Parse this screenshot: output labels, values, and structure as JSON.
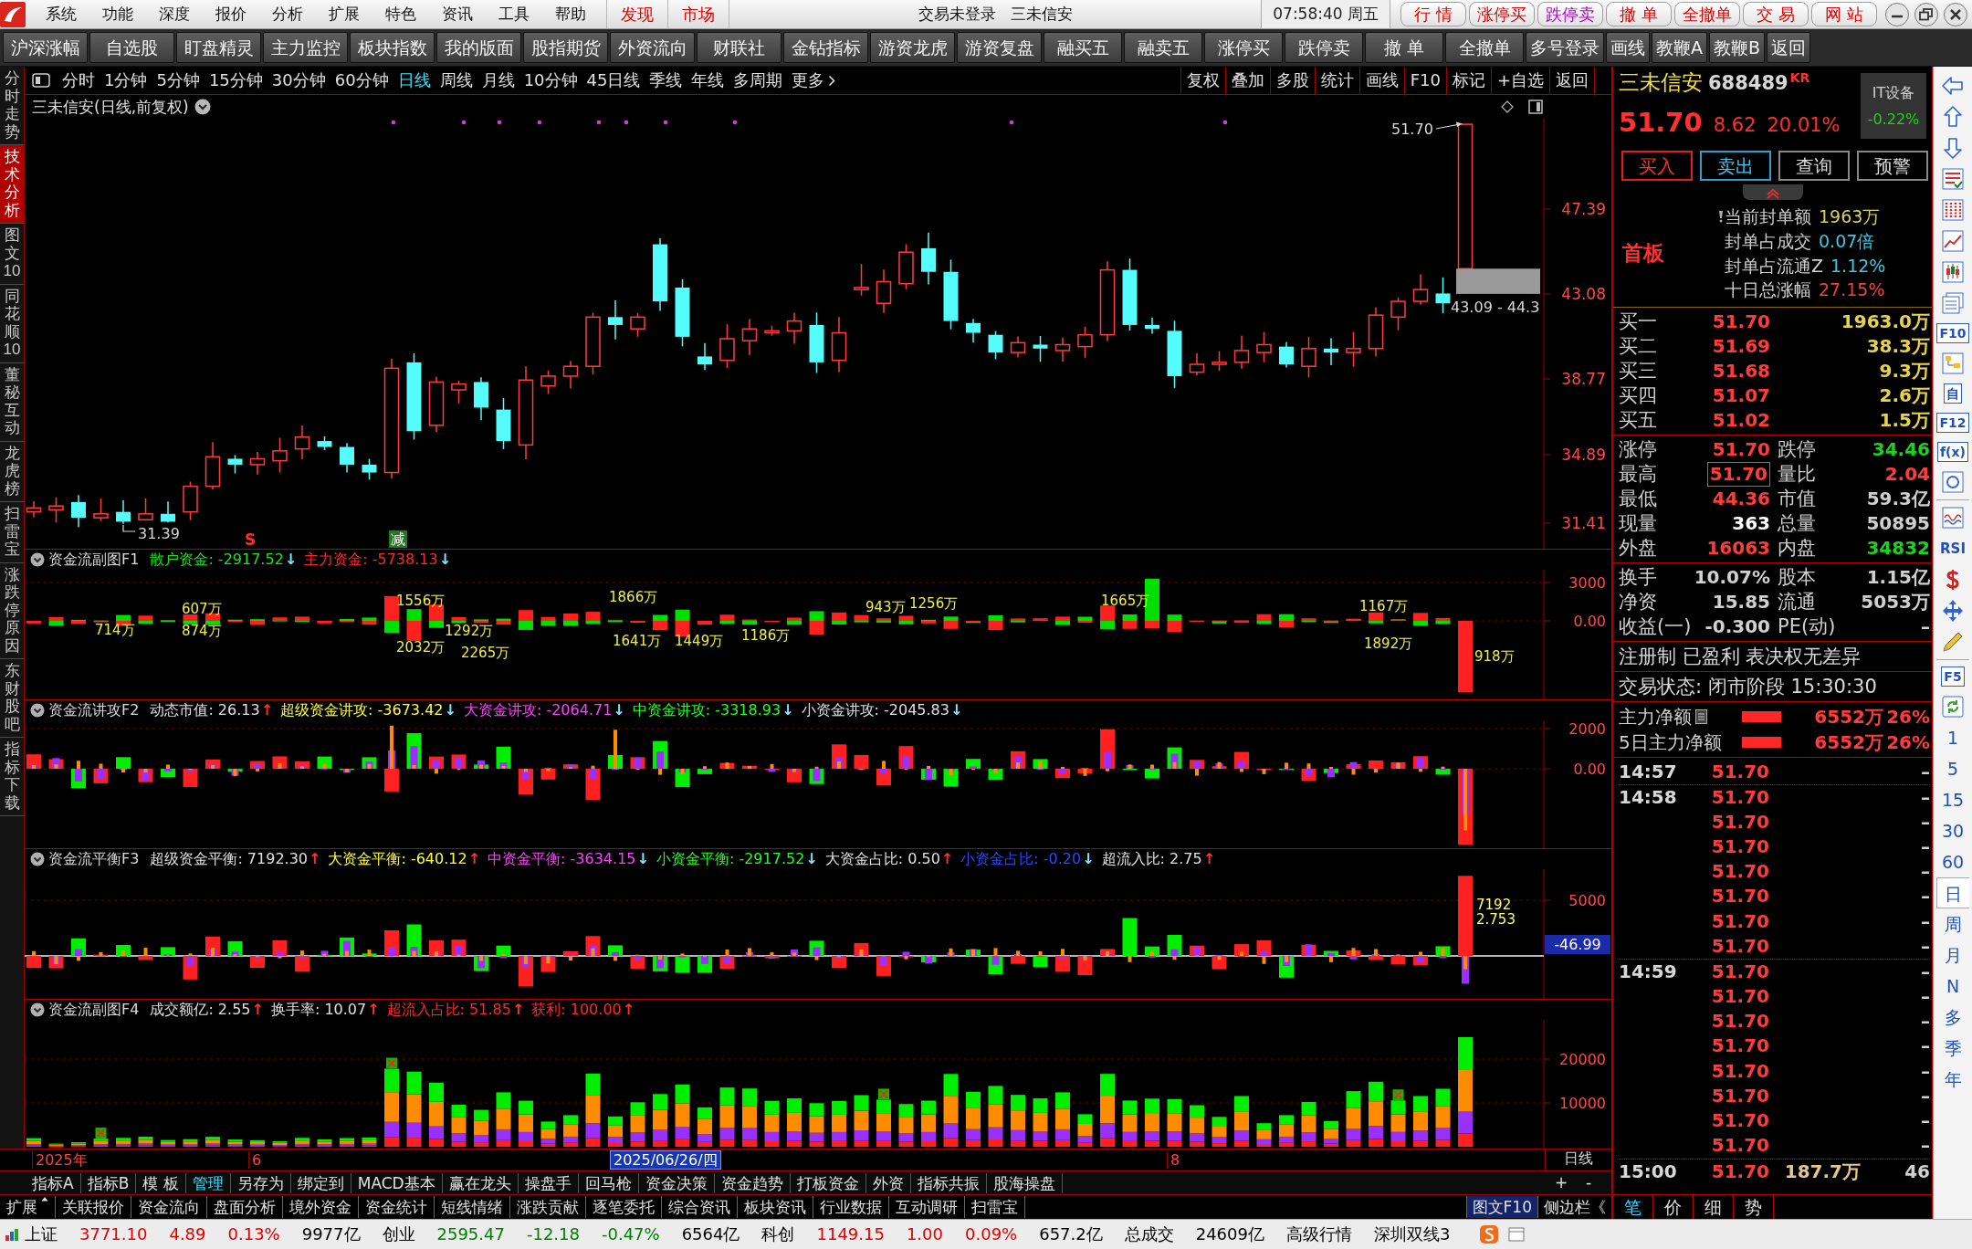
{
  "title_bar": {
    "menus": [
      "系统",
      "功能",
      "深度",
      "报价",
      "分析",
      "扩展",
      "特色",
      "资讯",
      "工具",
      "帮助"
    ],
    "channels": [
      "发现",
      "市场"
    ],
    "login_status": "交易未登录",
    "stock_name": "三未信安",
    "clock": "07:58:40 周五",
    "quick_buttons": [
      {
        "label": "行 情",
        "color": "#e00000"
      },
      {
        "label": "涨停买",
        "color": "#e00000"
      },
      {
        "label": "跌停卖",
        "color": "#b000c8"
      },
      {
        "label": "撤 单",
        "color": "#e00000"
      },
      {
        "label": "全撤单",
        "color": "#e00000"
      },
      {
        "label": "交 易",
        "color": "#e00000"
      },
      {
        "label": "网 站",
        "color": "#e00000"
      }
    ]
  },
  "toolbar": [
    "沪深涨幅",
    "自选股",
    "盯盘精灵",
    "主力监控",
    "板块指数",
    "我的版面",
    "股指期货",
    "外资流向",
    "财联社",
    "金钻指标",
    "游资龙虎",
    "游资复盘",
    "融买五",
    "融卖五",
    "涨停买",
    "跌停卖",
    "撤 单",
    "全撤单",
    "多号登录",
    "画线",
    "教鞭A",
    "教鞭B",
    "返回"
  ],
  "side_tabs": [
    {
      "label": "分时走势",
      "selected": false
    },
    {
      "label": "技术分析",
      "selected": true
    },
    {
      "label": "图文10",
      "selected": false
    },
    {
      "label": "同花顺10",
      "selected": false
    },
    {
      "label": "董秘互动",
      "selected": false
    },
    {
      "label": "龙虎榜",
      "selected": false
    },
    {
      "label": "扫雷宝",
      "selected": false
    },
    {
      "label": "涨跌停原因",
      "selected": false
    },
    {
      "label": "东财股吧",
      "selected": false
    },
    {
      "label": "指标下载",
      "selected": false
    }
  ],
  "period_bar": {
    "periods": [
      {
        "label": "分时",
        "selected": false
      },
      {
        "label": "1分钟",
        "selected": false
      },
      {
        "label": "5分钟",
        "selected": false
      },
      {
        "label": "15分钟",
        "selected": false
      },
      {
        "label": "30分钟",
        "selected": false
      },
      {
        "label": "60分钟",
        "selected": false
      },
      {
        "label": "日线",
        "selected": true
      },
      {
        "label": "周线",
        "selected": false
      },
      {
        "label": "月线",
        "selected": false
      },
      {
        "label": "10分钟",
        "selected": false
      },
      {
        "label": "45日线",
        "selected": false
      },
      {
        "label": "季线",
        "selected": false
      },
      {
        "label": "年线",
        "selected": false
      },
      {
        "label": "多周期",
        "selected": false
      }
    ],
    "more": "更多",
    "tools": [
      "复权",
      "叠加",
      "多股",
      "统计",
      "画线",
      "F10",
      "标记",
      "+自选",
      "返回"
    ]
  },
  "main_chart": {
    "title": "三未信安(日线,前复权)",
    "yticks": [
      "47.39",
      "43.08",
      "38.77",
      "34.89",
      "31.41"
    ],
    "high_label": "51.70",
    "range_label": "43.09 - 44.3",
    "low_label": "31.39",
    "markers": [
      {
        "kind": "sell",
        "label": "S"
      },
      {
        "kind": "reduce",
        "label": "减"
      }
    ]
  },
  "indicators": [
    {
      "title": "资金流副图F1",
      "readings": [
        {
          "kind": "value",
          "text": "散户资金: -2917.52",
          "color": "#20e020"
        },
        {
          "kind": "arrow",
          "text": "↓",
          "color": "#80e8ff"
        },
        {
          "kind": "value",
          "text": "主力资金: -5738.13",
          "color": "#ff2828"
        },
        {
          "kind": "arrow",
          "text": "↓",
          "color": "#80e8ff"
        }
      ],
      "yticks": [
        "3000",
        "0.00"
      ],
      "value_labels": [
        "714万",
        "607万",
        "874万",
        "1556万",
        "2032万",
        "1292万",
        "2265万",
        "1866万",
        "1641万",
        "1449万",
        "1186万",
        "943万",
        "1256万",
        "1665万",
        "1167万",
        "1892万",
        "918万"
      ]
    },
    {
      "title": "资金流讲攻F2",
      "readings": [
        {
          "kind": "value",
          "text": "动态市值: 26.13",
          "color": "#e0e0e0"
        },
        {
          "kind": "arrow",
          "text": "↑",
          "color": "#ff3030"
        },
        {
          "kind": "value",
          "text": "超级资金讲攻: -3673.42",
          "color": "#ffff30"
        },
        {
          "kind": "arrow",
          "text": "↓",
          "color": "#80e8ff"
        },
        {
          "kind": "value",
          "text": "大资金讲攻: -2064.71",
          "color": "#ff40ff"
        },
        {
          "kind": "arrow",
          "text": "↓",
          "color": "#80e8ff"
        },
        {
          "kind": "value",
          "text": "中资金讲攻: -3318.93",
          "color": "#20ff20"
        },
        {
          "kind": "arrow",
          "text": "↓",
          "color": "#80e8ff"
        },
        {
          "kind": "value",
          "text": "小资金讲攻: -2045.83",
          "color": "#e0e0e0"
        },
        {
          "kind": "arrow",
          "text": "↓",
          "color": "#80e8ff"
        }
      ],
      "yticks": [
        "2000",
        "0.00"
      ]
    },
    {
      "title": "资金流平衡F3",
      "readings": [
        {
          "kind": "value",
          "text": "超级资金平衡: 7192.30",
          "color": "#e0e0e0"
        },
        {
          "kind": "arrow",
          "text": "↑",
          "color": "#ff3030"
        },
        {
          "kind": "value",
          "text": "大资金平衡: -640.12",
          "color": "#ffff30"
        },
        {
          "kind": "arrow",
          "text": "↑",
          "color": "#ff3030"
        },
        {
          "kind": "value",
          "text": "中资金平衡: -3634.15",
          "color": "#ff40ff"
        },
        {
          "kind": "arrow",
          "text": "↓",
          "color": "#80e8ff"
        },
        {
          "kind": "value",
          "text": "小资金平衡: -2917.52",
          "color": "#20ff20"
        },
        {
          "kind": "arrow",
          "text": "↓",
          "color": "#80e8ff"
        },
        {
          "kind": "value",
          "text": "大资金占比: 0.50",
          "color": "#e0e0e0"
        },
        {
          "kind": "arrow",
          "text": "↑",
          "color": "#ff3030"
        },
        {
          "kind": "value",
          "text": "小资金占比: -0.20",
          "color": "#2848ff"
        },
        {
          "kind": "arrow",
          "text": "↓",
          "color": "#80e8ff"
        },
        {
          "kind": "value",
          "text": "超流入比: 2.75",
          "color": "#e0e0e0"
        },
        {
          "kind": "arrow",
          "text": "↑",
          "color": "#ff3030"
        }
      ],
      "yticks": [
        "5000"
      ],
      "current_value": "-46.99",
      "value_labels": [
        "7192",
        "2.753"
      ]
    },
    {
      "title": "资金流副图F4",
      "readings": [
        {
          "kind": "value",
          "text": "成交额亿: 2.55",
          "color": "#e0e0e0"
        },
        {
          "kind": "arrow",
          "text": "↑",
          "color": "#ff3030"
        },
        {
          "kind": "value",
          "text": "换手率: 10.07",
          "color": "#e0e0e0"
        },
        {
          "kind": "arrow",
          "text": "↑",
          "color": "#ff3030"
        },
        {
          "kind": "value",
          "text": "超流入占比: 51.85",
          "color": "#ff2828"
        },
        {
          "kind": "arrow",
          "text": "↑",
          "color": "#ff3030"
        },
        {
          "kind": "value",
          "text": "获利: 100.00",
          "color": "#ff2828"
        },
        {
          "kind": "arrow",
          "text": "↑",
          "color": "#ff3030"
        }
      ],
      "yticks": [
        "20000",
        "10000"
      ]
    }
  ],
  "date_axis": {
    "labels": [
      {
        "kind": "year",
        "text": "2025年"
      },
      {
        "kind": "month",
        "text": "6"
      },
      {
        "kind": "cursor",
        "text": "2025/06/26/四"
      },
      {
        "kind": "month",
        "text": "8"
      }
    ],
    "period": "日线"
  },
  "indicator_tabs": [
    {
      "label": "指标A",
      "selected": false
    },
    {
      "label": "指标B",
      "selected": false
    },
    {
      "label": "模 板",
      "selected": false
    },
    {
      "label": "管理",
      "selected": true
    },
    {
      "label": "另存为",
      "selected": false
    },
    {
      "label": "绑定到",
      "selected": false
    },
    {
      "label": "MACD基本",
      "selected": false
    },
    {
      "label": "赢在龙头",
      "selected": false
    },
    {
      "label": "操盘手",
      "selected": false
    },
    {
      "label": "回马枪",
      "selected": false
    },
    {
      "label": "资金决策",
      "selected": false
    },
    {
      "label": "资金趋势",
      "selected": false
    },
    {
      "label": "打板资金",
      "selected": false
    },
    {
      "label": "外资",
      "selected": false
    },
    {
      "label": "指标共振",
      "selected": false
    },
    {
      "label": "股海操盘",
      "selected": false
    }
  ],
  "zoom_buttons": [
    "+",
    "-"
  ],
  "bottom_tabs": {
    "expand": "扩展",
    "tabs": [
      "关联报价",
      "资金流向",
      "盘面分析",
      "境外资金",
      "资金统计",
      "短线情绪",
      "涨跌贡献",
      "逐笔委托",
      "综合资讯",
      "板块资讯",
      "行业数据",
      "互动调研",
      "扫雷宝"
    ],
    "side_links": [
      "图文F10",
      "侧边栏《"
    ]
  },
  "quote_panel": {
    "name": "三未信安",
    "code": "688489",
    "badge": "KR",
    "sector": "IT设备",
    "sector_change": "-0.22%",
    "price": "51.70",
    "change": "8.62",
    "change_pct": "20.01%",
    "actions": [
      {
        "label": "买入",
        "kind": "buy"
      },
      {
        "label": "卖出",
        "kind": "sell"
      },
      {
        "label": "查询",
        "kind": "plain"
      },
      {
        "label": "预警",
        "kind": "plain"
      }
    ],
    "board_tag": "首板",
    "seal_info": [
      {
        "label": "当前封单额",
        "value": "1963万",
        "color": "#d8d060"
      },
      {
        "label": "封单占成交",
        "value": "0.07倍",
        "color": "#40c8e0"
      },
      {
        "label": "封单占流通Z",
        "value": "1.12%",
        "color": "#40c8e0"
      },
      {
        "label": "十日总涨幅",
        "value": "27.15%",
        "color": "#f04040"
      }
    ],
    "bids": [
      {
        "label": "买一",
        "price": "51.70",
        "volume": "1963.0万"
      },
      {
        "label": "买二",
        "price": "51.69",
        "volume": "38.3万"
      },
      {
        "label": "买三",
        "price": "51.68",
        "volume": "9.3万"
      },
      {
        "label": "买四",
        "price": "51.07",
        "volume": "2.6万"
      },
      {
        "label": "买五",
        "price": "51.02",
        "volume": "1.5万"
      }
    ],
    "stats": [
      {
        "label": "涨停",
        "value": "51.70",
        "color": "#ff3c3c",
        "highlighted": false
      },
      {
        "label": "跌停",
        "value": "34.46",
        "color": "#20d020",
        "highlighted": false
      },
      {
        "label": "最高",
        "value": "51.70",
        "color": "#ff3c3c",
        "highlighted": true
      },
      {
        "label": "量比",
        "value": "2.04",
        "color": "#ff3c3c",
        "highlighted": false
      },
      {
        "label": "最低",
        "value": "44.36",
        "color": "#ff3c3c",
        "highlighted": false
      },
      {
        "label": "市值",
        "value": "59.3亿",
        "color": "#cfcfcf",
        "highlighted": false
      },
      {
        "label": "现量",
        "value": "363",
        "color": "#ffffff",
        "highlighted": false
      },
      {
        "label": "总量",
        "value": "50895",
        "color": "#cfcfcf",
        "highlighted": false
      },
      {
        "label": "外盘",
        "value": "16063",
        "color": "#ff3c3c",
        "highlighted": false
      },
      {
        "label": "内盘",
        "value": "34832",
        "color": "#20d020",
        "highlighted": false
      }
    ],
    "fundamentals": [
      {
        "label": "换手",
        "value": "10.07%"
      },
      {
        "label": "股本",
        "value": "1.15亿"
      },
      {
        "label": "净资",
        "value": "15.85"
      },
      {
        "label": "流通",
        "value": "5053万"
      },
      {
        "label": "收益(一)",
        "value": "-0.300"
      },
      {
        "label": "PE(动)",
        "value": "–"
      }
    ],
    "tags": "注册制 已盈利 表决权无差异",
    "trade_status": "交易状态: 闭市阶段 15:30:30",
    "net_flows": [
      {
        "label": "主力净额",
        "value": "6552万",
        "share": "26%"
      },
      {
        "label": "5日主力净额",
        "value": "6552万",
        "share": "26%"
      }
    ],
    "ticks": [
      {
        "time": "14:57",
        "price": "51.70",
        "count": "–"
      },
      {
        "time": "14:58",
        "price": "51.70",
        "count": "–"
      },
      {
        "price": "51.70",
        "count": "–"
      },
      {
        "price": "51.70",
        "count": "–"
      },
      {
        "price": "51.70",
        "count": "–"
      },
      {
        "price": "51.70",
        "count": "–"
      },
      {
        "price": "51.70",
        "count": "–"
      },
      {
        "price": "51.70",
        "count": "–"
      },
      {
        "time": "14:59",
        "price": "51.70",
        "count": "–"
      },
      {
        "price": "51.70",
        "count": "–"
      },
      {
        "price": "51.70",
        "count": "–"
      },
      {
        "price": "51.70",
        "count": "–"
      },
      {
        "price": "51.70",
        "count": "–"
      },
      {
        "price": "51.70",
        "count": "–"
      },
      {
        "price": "51.70",
        "count": "–"
      },
      {
        "price": "51.70",
        "count": "–"
      },
      {
        "time": "15:00",
        "price": "51.70",
        "volume": "187.7万",
        "count": "46"
      }
    ],
    "detail_tabs": [
      {
        "label": "笔",
        "selected": true
      },
      {
        "label": "价",
        "selected": false
      },
      {
        "label": "细",
        "selected": false
      },
      {
        "label": "势",
        "selected": false
      }
    ]
  },
  "right_strip": {
    "tools": [
      {
        "kind": "icon"
      },
      {
        "kind": "icon"
      },
      {
        "kind": "icon"
      },
      {
        "kind": "icon"
      },
      {
        "kind": "icon"
      },
      {
        "kind": "icon"
      },
      {
        "kind": "icon"
      },
      {
        "kind": "icon"
      },
      {
        "kind": "key",
        "label": "F10"
      },
      {
        "kind": "icon"
      },
      {
        "kind": "key",
        "label": "自"
      },
      {
        "kind": "key",
        "label": "F12"
      },
      {
        "kind": "key",
        "label": "f(x)"
      },
      {
        "kind": "icon"
      },
      {
        "kind": "divider"
      },
      {
        "kind": "icon"
      },
      {
        "kind": "label",
        "label": "RSI"
      },
      {
        "kind": "icon"
      },
      {
        "kind": "icon"
      },
      {
        "kind": "icon"
      },
      {
        "kind": "divider"
      },
      {
        "kind": "key",
        "label": "F5"
      },
      {
        "kind": "icon"
      }
    ],
    "periods": [
      {
        "label": "1",
        "selected": false
      },
      {
        "label": "5",
        "selected": false
      },
      {
        "label": "15",
        "selected": false
      },
      {
        "label": "30",
        "selected": false
      },
      {
        "label": "60",
        "selected": false
      },
      {
        "label": "日",
        "selected": true
      },
      {
        "label": "周",
        "selected": false
      },
      {
        "label": "月",
        "selected": false
      },
      {
        "label": "N",
        "selected": false
      },
      {
        "label": "多",
        "selected": false
      },
      {
        "label": "季",
        "selected": false
      },
      {
        "label": "年",
        "selected": false
      }
    ]
  },
  "status_bar": {
    "items": [
      {
        "text": "上证",
        "color": "#000000"
      },
      {
        "text": "3771.10",
        "color": "#e00000"
      },
      {
        "text": "4.89",
        "color": "#e00000"
      },
      {
        "text": "0.13%",
        "color": "#e00000"
      },
      {
        "text": "9977亿",
        "color": "#000000"
      },
      {
        "text": "创业",
        "color": "#000000"
      },
      {
        "text": "2595.47",
        "color": "#008000"
      },
      {
        "text": "-12.18",
        "color": "#008000"
      },
      {
        "text": "-0.47%",
        "color": "#008000"
      },
      {
        "text": "6564亿",
        "color": "#000000"
      },
      {
        "text": "科创",
        "color": "#000000"
      },
      {
        "text": "1149.15",
        "color": "#e00000"
      },
      {
        "text": "1.00",
        "color": "#e00000"
      },
      {
        "text": "0.09%",
        "color": "#e00000"
      },
      {
        "text": "657.2亿",
        "color": "#000000"
      },
      {
        "text": "总成交",
        "color": "#000000"
      },
      {
        "text": "24609亿",
        "color": "#000000"
      },
      {
        "text": "高级行情",
        "color": "#000000"
      },
      {
        "text": "深圳双线3",
        "color": "#000000"
      }
    ]
  }
}
